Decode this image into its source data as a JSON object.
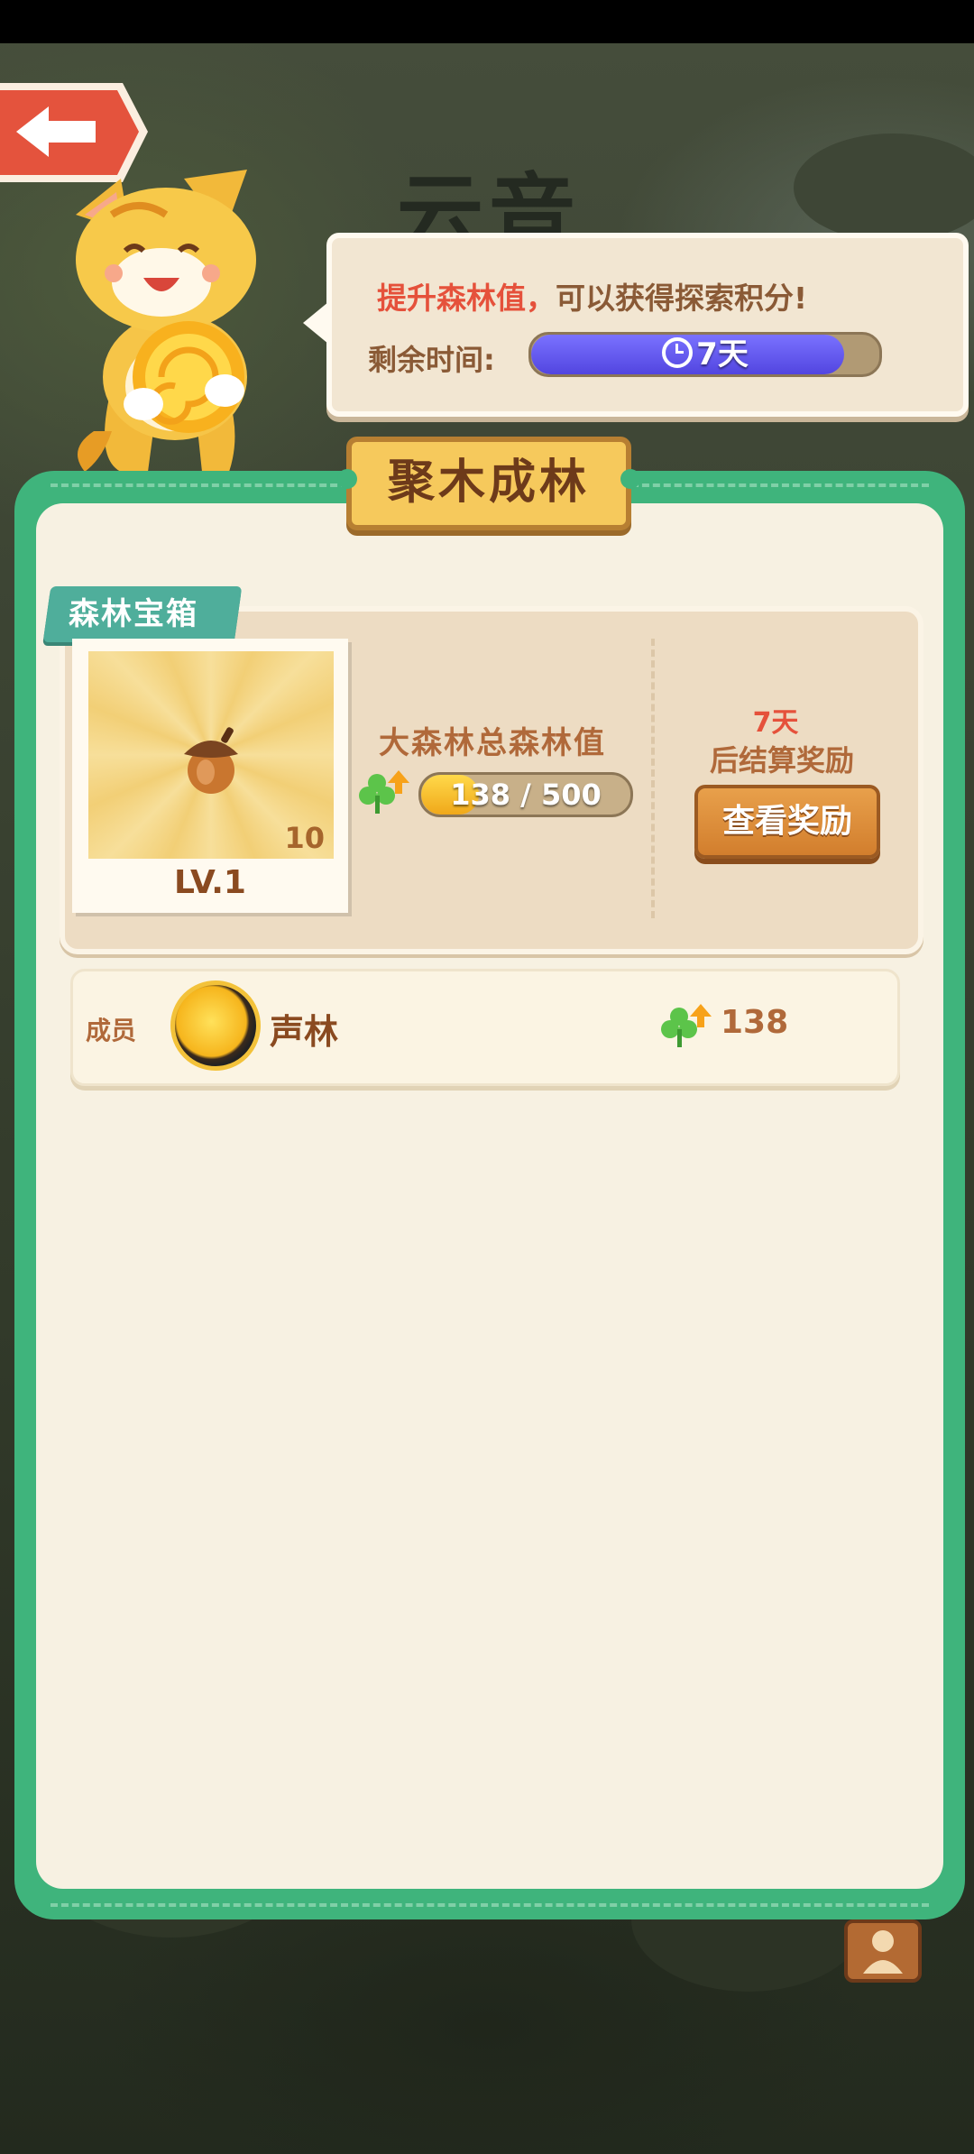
{
  "background": {
    "title": "云音"
  },
  "header": {
    "back_icon": "arrow-left-icon",
    "hint_prefix": "提升森林值，",
    "hint_suffix": "可以获得探索积分!",
    "time_label": "剩余时间:",
    "time_value": "7天",
    "time_progress": 0.9
  },
  "panel": {
    "title": "聚木成林",
    "chest": {
      "tag": "森林宝箱",
      "item_icon": "acorn-icon",
      "item_count": "10",
      "level": "LV.1"
    },
    "forest": {
      "title": "大森林总森林值",
      "progress_text": "138 / 500",
      "progress_value": 138,
      "progress_max": 500
    },
    "settle": {
      "days": "7天",
      "text": "后结算奖励",
      "button": "查看奖励"
    },
    "member": {
      "label": "成员",
      "name": "声林",
      "score": "138"
    }
  },
  "colors": {
    "panel_green": "#3fb47c",
    "accent_red": "#e5513b",
    "text_brown": "#8a4a20"
  }
}
